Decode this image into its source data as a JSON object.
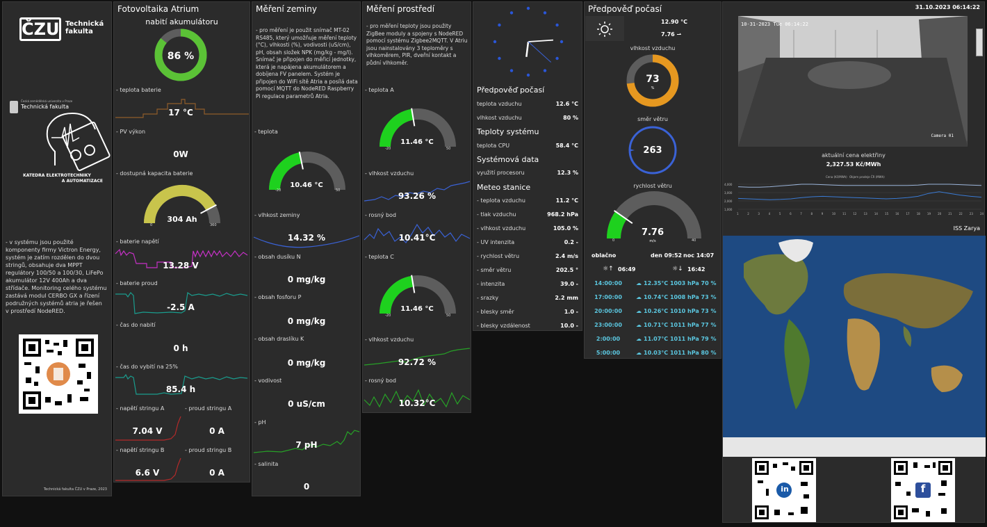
{
  "logo": {
    "name": "Technická\nfakulta",
    "mark": "ČZU",
    "uni": "Česká zemědělská univerzita v Praze",
    "uni_name": "Technická fakulta",
    "dept1": "KATEDRA ELEKTROTECHNIKY",
    "dept2": "A AUTOMATIZACE",
    "desc": "- v systému jsou použité komponenty firmy Victron Energy, systém je zatím rozdělen do dvou stringů, obsahuje dva MPPT regulátory 100/50 a 100/30, LiFePo akumulátor 12V 400Ah a dva střídače. Monitoring celého systému zastává modul CERBO GX a řízení podružných systémů atria je řešen v prostředí NodeRED.",
    "footer": "Technická fakulta ČZU v Praze, 2023"
  },
  "pv": {
    "title": "Fotovoltaika Atrium",
    "charge_title": "nabití akumulátoru",
    "charge": "86 %",
    "charge_pct": 86,
    "l_temp": "- teplota baterie",
    "temp": "17 °C",
    "l_pv": "- PV výkon",
    "pv": "0W",
    "l_cap": "- dostupná kapacita baterie",
    "cap": "304 Ah",
    "cap_min": "0",
    "cap_max": "360",
    "cap_val": 304,
    "l_volt": "- baterie napětí",
    "volt": "13.28 V",
    "l_cur": "- baterie proud",
    "cur": "-2.5 A",
    "l_tcharge": "- čas do nabití",
    "tcharge": "0 h",
    "l_tdis": "- čas do vybití na 25%",
    "tdis": "85.4 h",
    "l_sa": "- napětí stringu A",
    "sa": "7.04 V",
    "l_ia": "- proud stringu A",
    "ia": "0 A",
    "l_sb": "- napětí stringu B",
    "sb": "6.6 V",
    "l_ib": "- proud stringu B",
    "ib": "0 A"
  },
  "soil": {
    "title": "Měření zeminy",
    "desc": "- pro měření je použit snímač MT-02 RS485, který umožňuje měření teploty (°C), vlhkosti (%), vodivosti (uS/cm), pH, obsah složek NPK (mg/kg - mg/l). Snímač je připojen do měřicí jednotky, která je napájena akumulátorem a dobíjena FV panelem. Systém je připojen do WiFi sítě Atria a posílá data pomocí MQTT do NodeRED Raspberry Pi regulace parametrů Atria.",
    "l_temp": "- teplota",
    "temp": "10.46 °C",
    "temp_min": "-20",
    "temp_max": "50",
    "temp_val": 10.46,
    "l_hum": "- vlhkost zeminy",
    "hum": "14.32 %",
    "l_n": "- obsah dusíku N",
    "n": "0 mg/kg",
    "l_p": "- obsah fosforu P",
    "p": "0 mg/kg",
    "l_k": "- obsah draslíku K",
    "k": "0 mg/kg",
    "l_cond": "- vodivost",
    "cond": "0 uS/cm",
    "l_ph": "- pH",
    "ph": "7 pH",
    "l_sal": "- salinita",
    "sal": "0"
  },
  "env": {
    "title": "Měření prostředí",
    "desc": "- pro měření teploty jsou použity ZigBee moduly a spojeny s NodeRED pomocí systému Zigbee2MQTT. V Atriu jsou nainstalovány 3 teploměry s vlhkoměrem, PIR, dveřní kontakt a půdní vlhkoměr.",
    "l_ta": "- teplota A",
    "ta": "11.46 °C",
    "ta_min": "-20",
    "ta_max": "50",
    "ta_val": 11.46,
    "l_ha": "- vlhkost vzduchu",
    "ha": "93.26 %",
    "l_da": "- rosný bod",
    "da": "10.41°C",
    "l_tc": "- teplota C",
    "tc": "11.46 °C",
    "tc_min": "-20",
    "tc_max": "50",
    "tc_val": 11.46,
    "l_hc": "- vlhkost vzduchu",
    "hc": "92.72 %",
    "l_dc": "- rosný bod",
    "dc": "10.32°C"
  },
  "stats": {
    "h_fc": "Předpověď počasí",
    "l_air": "teplota vzduchu",
    "air": "12.6 °C",
    "l_hum": "vlhkost vzduchu",
    "hum": "80 %",
    "h_sys": "Teploty systému",
    "l_cpu": "teplota CPU",
    "cpu": "58.4 °C",
    "h_sd": "Systémová data",
    "l_use": "využití procesoru",
    "use": "12.3 %",
    "h_met": "Meteo stanice",
    "met": [
      {
        "l": "- teplota vzduchu",
        "v": "11.2 °C"
      },
      {
        "l": "- tlak vzduchu",
        "v": "968.2 hPa"
      },
      {
        "l": "- vlhkost vzduchu",
        "v": "105.0 %"
      },
      {
        "l": "- UV intenzita",
        "v": "0.2 -"
      },
      {
        "l": "- rychlost větru",
        "v": "2.4 m/s"
      },
      {
        "l": "- směr větru",
        "v": "202.5 °"
      },
      {
        "l": "- intenzita",
        "v": "39.0 -"
      },
      {
        "l": "- srazky",
        "v": "2.2 mm"
      },
      {
        "l": "- blesky směr",
        "v": "1.0 -"
      },
      {
        "l": "- blesky vzdálenost",
        "v": "10.0 -"
      }
    ]
  },
  "weather": {
    "title": "Předpověď počasí",
    "temp": "12.90 °C",
    "wind": "7.76 ⇀",
    "l_hum": "vlhkost vzduchu",
    "hum": "73",
    "hum_unit": "%",
    "hum_pct": 73,
    "l_dir": "směr větru",
    "dir": "263",
    "l_speed": "rychlost větru",
    "speed": "7.76",
    "speed_unit": "m/s",
    "speed_min": "0",
    "speed_max": "40",
    "speed_val": 7.76,
    "cond": "oblačno",
    "day": "den 09:52",
    "night": "noc 14:07",
    "rise": "06:49",
    "set": "16:42",
    "rows": [
      {
        "t": "14:00:00",
        "v": "12.35°C 1003 hPa 70 %"
      },
      {
        "t": "17:00:00",
        "v": "10.74°C 1008 hPa 73 %"
      },
      {
        "t": "20:00:00",
        "v": "10.26°C 1010 hPa 73 %"
      },
      {
        "t": "23:00:00",
        "v": "10.71°C 1011 hPa 77 %"
      },
      {
        "t": "2:00:00",
        "v": "11.07°C 1011 hPa 79 %"
      },
      {
        "t": "5:00:00",
        "v": "10.03°C 1011 hPa 80 %"
      }
    ]
  },
  "right": {
    "datetime": "31.10.2023 06:14:22",
    "cam_ts": "10-31-2023 Tue 06:14:22",
    "cam_name": "Camera 01",
    "price_title": "aktuální cena elektřiny",
    "price": "2,327.53 Kč/MWh",
    "legend1": "Cena (Kč/MWh)",
    "legend2": "Objem prodeje ČR (MWh)",
    "yticks": [
      "4,000",
      "3,000",
      "2,000",
      "1,000"
    ],
    "xticks": [
      "1",
      "2",
      "3",
      "4",
      "5",
      "6",
      "7",
      "8",
      "9",
      "10",
      "11",
      "12",
      "13",
      "14",
      "15",
      "16",
      "17",
      "18",
      "19",
      "20",
      "21",
      "22",
      "23",
      "24"
    ],
    "iss": "ISS Zarya"
  },
  "chart_data": {
    "type": "line",
    "categories": [
      "1",
      "2",
      "3",
      "4",
      "5",
      "6",
      "7",
      "8",
      "9",
      "10",
      "11",
      "12",
      "13",
      "14",
      "15",
      "16",
      "17",
      "18",
      "19",
      "20",
      "21",
      "22",
      "23",
      "24"
    ],
    "series": [
      {
        "name": "Cena (Kč/MWh)",
        "values": [
          2300,
          2250,
          2200,
          2150,
          2180,
          2250,
          2400,
          2500,
          2550,
          2500,
          2450,
          2400,
          2350,
          2300,
          2250,
          2300,
          2400,
          2550,
          2900,
          3100,
          2900,
          2700,
          2550,
          2450
        ]
      },
      {
        "name": "Objem prodeje ČR (MWh)",
        "values": [
          3700,
          3650,
          3650,
          3700,
          3800,
          3900,
          4000,
          4000,
          3950,
          3900,
          3850,
          3850,
          3850,
          3850,
          3850,
          3850,
          3850,
          3900,
          4000,
          4000,
          4000,
          3950,
          3900,
          3850
        ]
      }
    ],
    "ylim": [
      1000,
      4000
    ]
  },
  "colors": {
    "green": "#1ed11e",
    "gray": "#5d5d5d",
    "yellow": "#c8c44c",
    "orange": "#e69820",
    "blue": "#3a62d6",
    "teal": "#1a9d8e",
    "magenta": "#c531c5",
    "red": "#b52a2a",
    "olive": "#8f5c2a"
  }
}
